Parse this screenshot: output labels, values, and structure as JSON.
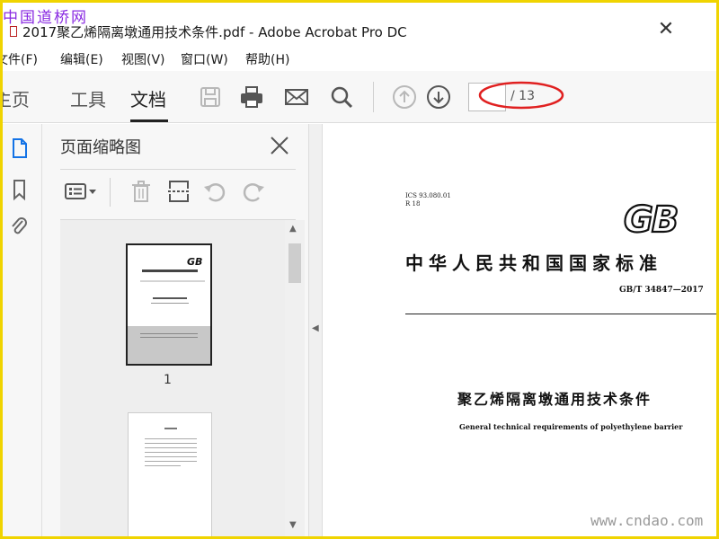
{
  "watermark_top": "中国道桥网",
  "watermark_bottom": "www.cndao.com",
  "window": {
    "title": "2017聚乙烯隔离墩通用技术条件.pdf - Adobe Acrobat Pro DC",
    "close_glyph": "✕"
  },
  "menu": [
    "文件(F)",
    "编辑(E)",
    "视图(V)",
    "窗口(W)",
    "帮助(H)"
  ],
  "tabs": [
    {
      "label": "主页",
      "active": false
    },
    {
      "label": "工具",
      "active": false
    },
    {
      "label": "文档",
      "active": true
    }
  ],
  "toolbar": {
    "icons": [
      "save-icon",
      "print-icon",
      "email-icon",
      "search-icon",
      "prev-page-icon",
      "next-page-icon"
    ],
    "page_current": "",
    "page_total": "/ 13",
    "highlight_color": "#e02020"
  },
  "nav_rail": {
    "icons": [
      "page-thumbnails-icon",
      "bookmark-icon",
      "attachment-icon"
    ],
    "accent": "#1473e6"
  },
  "thumbnails_panel": {
    "title": "页面缩略图",
    "tools": [
      "options-menu-icon",
      "delete-icon",
      "extract-icon",
      "rotate-ccw-icon",
      "rotate-cw-icon"
    ],
    "pages": [
      {
        "label": "1",
        "selected": true
      },
      {
        "label": "",
        "selected": false
      }
    ]
  },
  "document": {
    "ics": "ICS 93.080.01",
    "ccs": "R 18",
    "logo": "GB",
    "national_title": "中华人民共和国国家标准",
    "standard_number": "GB/T 34847—2017",
    "title_cn": "聚乙烯隔离墩通用技术条件",
    "title_en": "General technical requirements of polyethylene barrier"
  }
}
